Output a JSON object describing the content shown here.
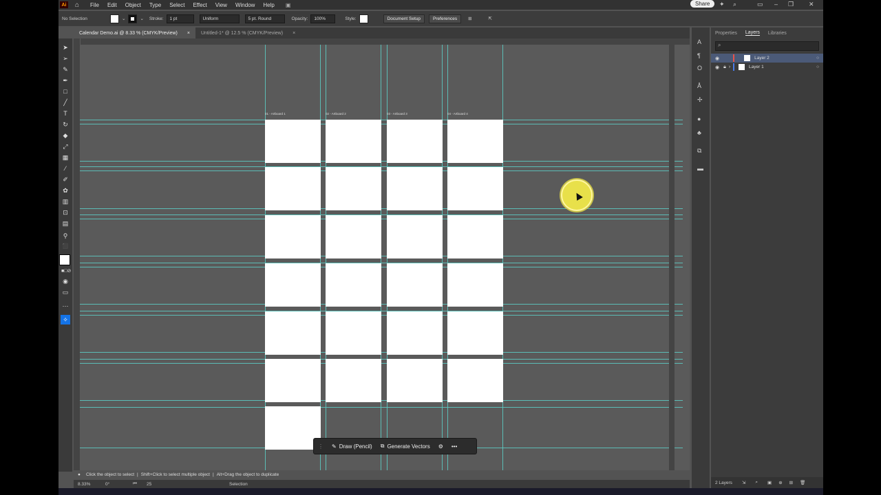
{
  "menubar": {
    "logo": "Ai",
    "items": [
      "File",
      "Edit",
      "Object",
      "Type",
      "Select",
      "Effect",
      "View",
      "Window",
      "Help"
    ],
    "share_label": "Share"
  },
  "control": {
    "selection": "No Selection",
    "stroke_label": "Stroke:",
    "stroke_value": "1 pt",
    "profile": "Uniform",
    "brush": "5 pt. Round",
    "opacity_label": "Opacity:",
    "opacity_value": "100%",
    "style_label": "Style:",
    "doc_setup": "Document Setup",
    "preferences": "Preferences"
  },
  "tabs": [
    {
      "label": "Calendar Demo.ai @ 8.33 % (CMYK/Preview)",
      "close": "×"
    },
    {
      "label": "Untitled-1* @ 12.5 % (CMYK/Preview)",
      "close": "×"
    }
  ],
  "artboard_labels": [
    "01 - Artboard 1",
    "02 - Artboard 2",
    "03 - Artboard 3",
    "04 - Artboard 4"
  ],
  "context_bar": {
    "draw": "Draw (Pencil)",
    "generate": "Generate Vectors",
    "more": "•••"
  },
  "hint": {
    "text1": "Click the object to select",
    "text2": "Shift+Click to select multiple object",
    "text3": "Alt+Drag the object to duplicate"
  },
  "status": {
    "zoom": "8.33%",
    "rotate": "0°",
    "artboard": "25",
    "tool": "Selection"
  },
  "panel": {
    "tabs": [
      "Properties",
      "Layers",
      "Libraries"
    ],
    "active_tab": "Layers",
    "layers": [
      {
        "name": "Layer 2",
        "selected": true,
        "color": "#e8534a"
      },
      {
        "name": "Layer 1",
        "selected": false,
        "color": "#4a7be8"
      }
    ],
    "footer": "2 Layers"
  },
  "colors": {
    "guide": "#5cc8c0",
    "accent": "#1473e6",
    "cursor_highlight": "#e8e04a"
  }
}
